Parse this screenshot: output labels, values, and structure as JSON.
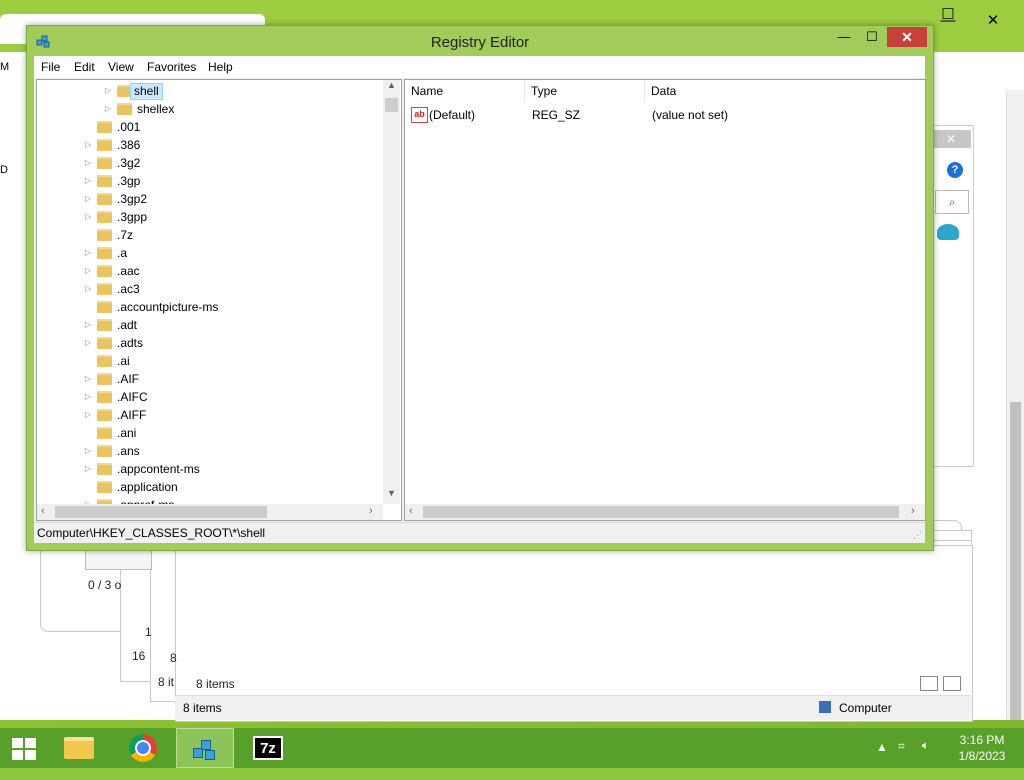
{
  "registry": {
    "title": "Registry Editor",
    "controls": {
      "minimize": "—",
      "maximize": "☐",
      "close": "✕"
    },
    "menu": [
      "File",
      "Edit",
      "View",
      "Favorites",
      "Help"
    ],
    "tree": [
      {
        "label": "shell",
        "level": 2,
        "expandable": true,
        "selected": true
      },
      {
        "label": "shellex",
        "level": 2,
        "expandable": true
      },
      {
        "label": ".001",
        "level": 1,
        "expandable": false
      },
      {
        "label": ".386",
        "level": 1,
        "expandable": true
      },
      {
        "label": ".3g2",
        "level": 1,
        "expandable": true
      },
      {
        "label": ".3gp",
        "level": 1,
        "expandable": true
      },
      {
        "label": ".3gp2",
        "level": 1,
        "expandable": true
      },
      {
        "label": ".3gpp",
        "level": 1,
        "expandable": true
      },
      {
        "label": ".7z",
        "level": 1,
        "expandable": false
      },
      {
        "label": ".a",
        "level": 1,
        "expandable": true
      },
      {
        "label": ".aac",
        "level": 1,
        "expandable": true
      },
      {
        "label": ".ac3",
        "level": 1,
        "expandable": true
      },
      {
        "label": ".accountpicture-ms",
        "level": 1,
        "expandable": false
      },
      {
        "label": ".adt",
        "level": 1,
        "expandable": true
      },
      {
        "label": ".adts",
        "level": 1,
        "expandable": true
      },
      {
        "label": ".ai",
        "level": 1,
        "expandable": false
      },
      {
        "label": ".AIF",
        "level": 1,
        "expandable": true
      },
      {
        "label": ".AIFC",
        "level": 1,
        "expandable": true
      },
      {
        "label": ".AIFF",
        "level": 1,
        "expandable": true
      },
      {
        "label": ".ani",
        "level": 1,
        "expandable": false
      },
      {
        "label": ".ans",
        "level": 1,
        "expandable": true
      },
      {
        "label": ".appcontent-ms",
        "level": 1,
        "expandable": true
      },
      {
        "label": ".application",
        "level": 1,
        "expandable": false
      },
      {
        "label": ".appref-ms",
        "level": 1,
        "expandable": true
      }
    ],
    "columns": {
      "name": "Name",
      "type": "Type",
      "data": "Data"
    },
    "values": [
      {
        "name": "(Default)",
        "type": "REG_SZ",
        "data": "(value not set)",
        "icon": "ab"
      }
    ],
    "status_path": "Computer\\HKEY_CLASSES_ROOT\\*\\shell"
  },
  "background": {
    "left_letters": [
      "M",
      "D"
    ],
    "scroll_status": "0 / 3 o",
    "num_1": "1",
    "num_16": "16",
    "num_8": "8",
    "items_8it": "8 it",
    "items_inner": "8 items",
    "items_status": "8 items",
    "computer_label": "Computer"
  },
  "taskbar": {
    "time": "3:16 PM",
    "date": "1/8/2023",
    "apps": [
      "start",
      "file-explorer",
      "chrome",
      "registry-editor",
      "7-zip"
    ]
  }
}
